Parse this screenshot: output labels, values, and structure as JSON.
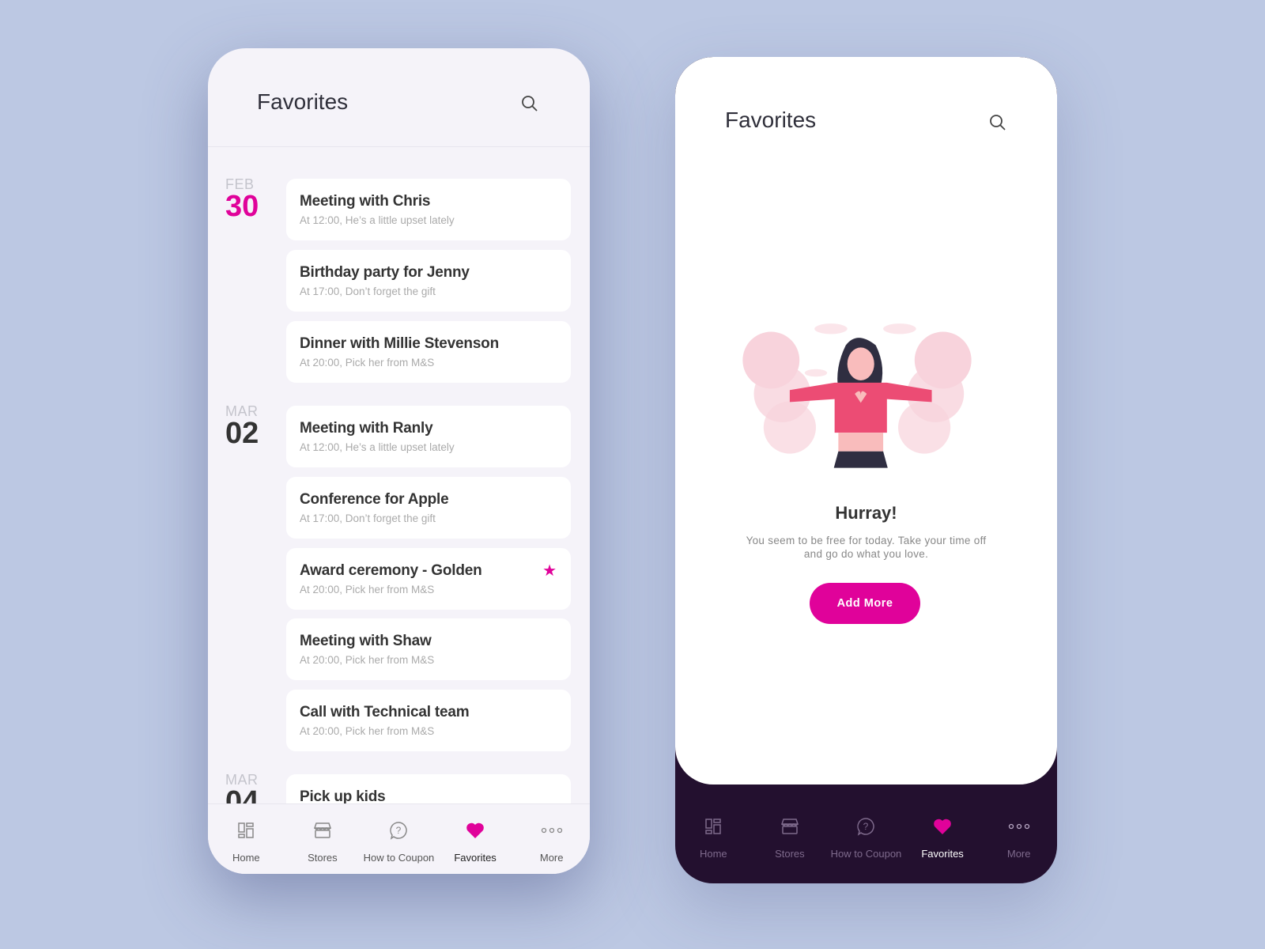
{
  "colors": {
    "accent": "#e0029a",
    "background": "#bcc8e3",
    "dark_nav": "#23102f"
  },
  "left_screen": {
    "title": "Favorites",
    "groups": [
      {
        "month": "FEB",
        "day": "30",
        "highlight": true,
        "items": [
          {
            "title": "Meeting with Chris",
            "subtitle": "At 12:00,  He’s a little upset lately"
          },
          {
            "title": "Birthday party for Jenny",
            "subtitle": "At 17:00,  Don’t forget the gift"
          },
          {
            "title": "Dinner with Millie Stevenson",
            "subtitle": "At 20:00,  Pick her from M&S"
          }
        ]
      },
      {
        "month": "MAR",
        "day": "02",
        "items": [
          {
            "title": "Meeting with Ranly",
            "subtitle": "At 12:00,  He’s a little upset lately"
          },
          {
            "title": "Conference for Apple",
            "subtitle": "At 17:00,  Don’t forget the gift"
          },
          {
            "title": "Award ceremony - Golden",
            "subtitle": "At 20:00,  Pick her from M&S",
            "starred": true
          },
          {
            "title": "Meeting with Shaw",
            "subtitle": "At 20:00,  Pick her from M&S"
          },
          {
            "title": "Call with Technical team",
            "subtitle": "At 20:00,  Pick her from M&S"
          }
        ]
      },
      {
        "month": "MAR",
        "day": "04",
        "items": [
          {
            "title": "Pick up kids",
            "subtitle": ""
          }
        ]
      }
    ]
  },
  "right_screen": {
    "title": "Favorites",
    "empty_title": "Hurray!",
    "empty_message_line1": "You seem to be free for today. Take your time off",
    "empty_message_line2": "and go do what you love.",
    "button": "Add More"
  },
  "nav": [
    {
      "label": "Home",
      "icon": "dashboard-icon"
    },
    {
      "label": "Stores",
      "icon": "store-icon"
    },
    {
      "label": "How to Coupon",
      "icon": "help-bubble-icon"
    },
    {
      "label": "Favorites",
      "icon": "heart-icon",
      "active": true
    },
    {
      "label": "More",
      "icon": "more-dots-icon"
    }
  ]
}
